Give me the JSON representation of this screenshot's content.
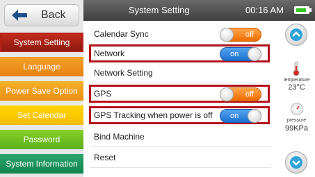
{
  "sidebar": {
    "back_label": "Back",
    "items": [
      {
        "label": "System Setting"
      },
      {
        "label": "Language"
      },
      {
        "label": "Power Save Option"
      },
      {
        "label": "Set Calendar"
      },
      {
        "label": "Password"
      },
      {
        "label": "System Information"
      }
    ]
  },
  "header": {
    "title": "System Setting",
    "time": "00:16 AM",
    "battery_level": 0.85
  },
  "settings": [
    {
      "label": "Calendar Sync",
      "toggle": "off"
    },
    {
      "label": "Network",
      "toggle": "on"
    },
    {
      "label": "Network Setting"
    },
    {
      "label": "GPS",
      "toggle": "off"
    },
    {
      "label": "GPS Tracking when power is off",
      "toggle": "on"
    },
    {
      "label": "Bind Machine"
    },
    {
      "label": "Reset"
    }
  ],
  "sensors": {
    "temperature_label": "temperature",
    "temperature_value": "23°C",
    "pressure_label": "pressure",
    "pressure_value": "99KPa"
  },
  "colors": {
    "highlight": "#b5121b",
    "toggle_on": "#1c6fcf",
    "toggle_off": "#f06c00"
  }
}
